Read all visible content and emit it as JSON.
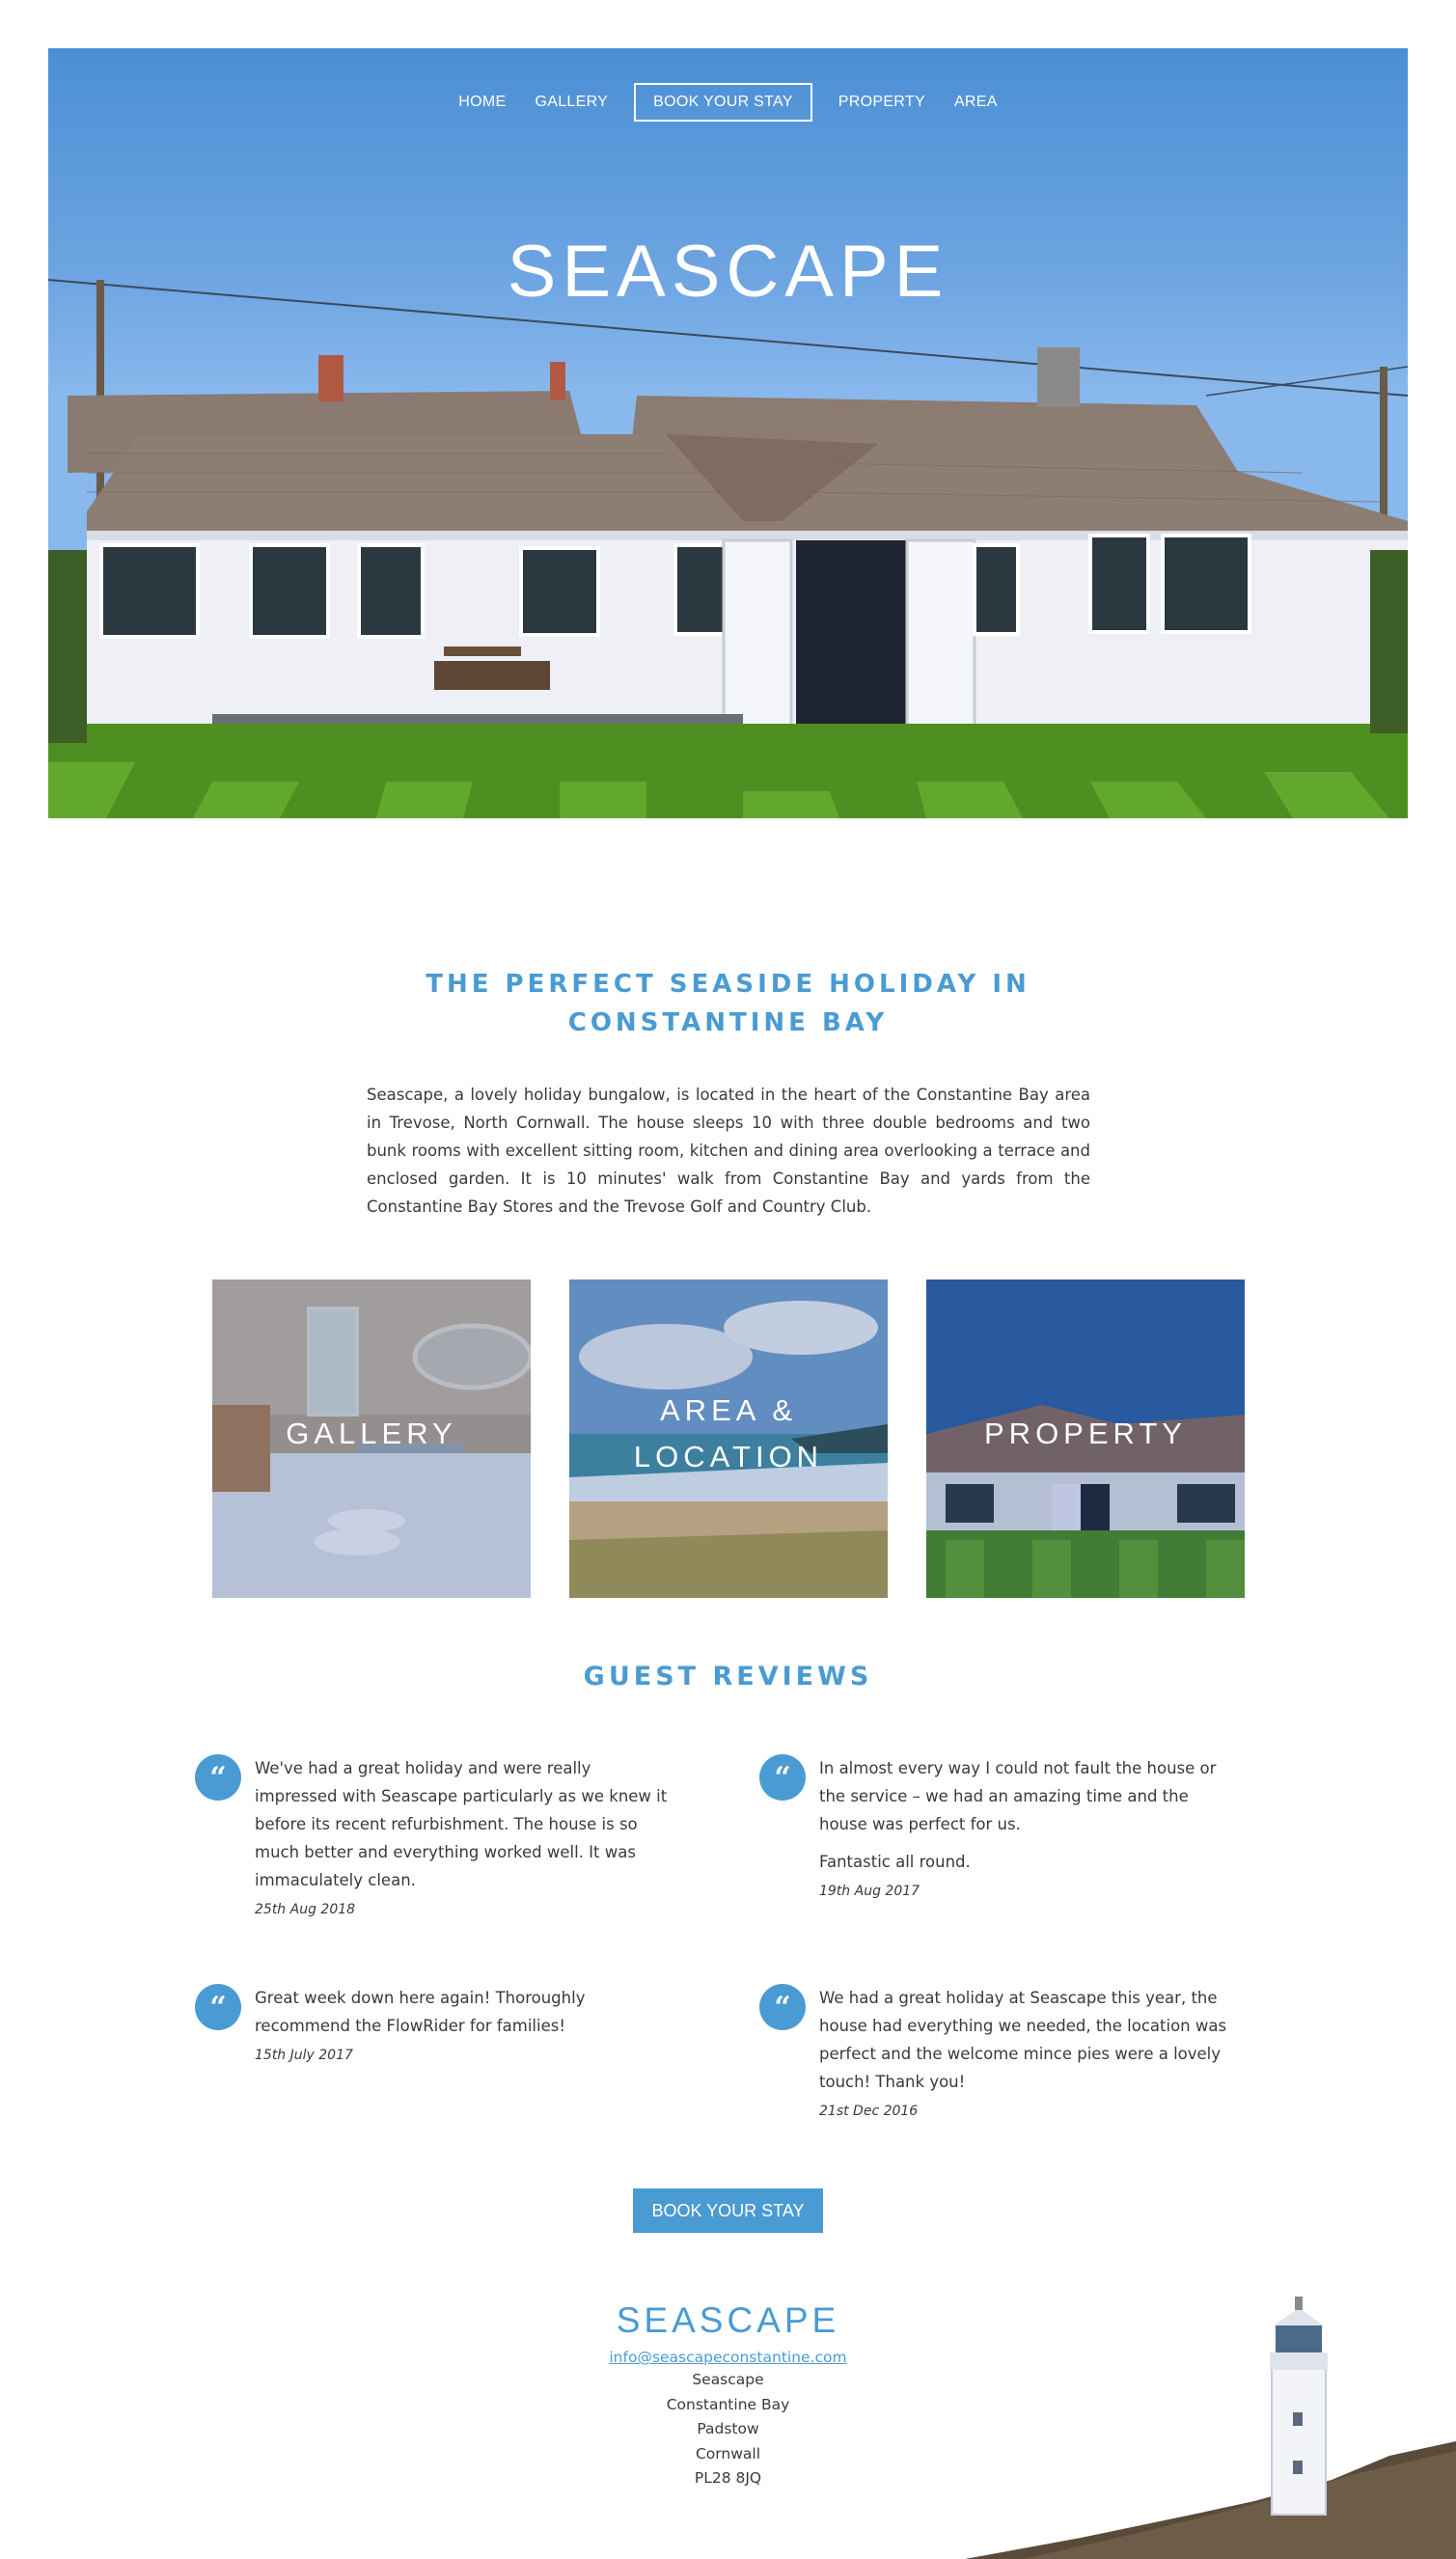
{
  "nav": {
    "items": [
      {
        "label": "HOME"
      },
      {
        "label": "GALLERY"
      },
      {
        "label": "BOOK YOUR STAY"
      },
      {
        "label": "PROPERTY"
      },
      {
        "label": "AREA"
      }
    ]
  },
  "hero": {
    "logo": "SEASCAPE"
  },
  "intro": {
    "title_line1": "THE PERFECT SEASIDE HOLIDAY IN",
    "title_line2": "CONSTANTINE BAY",
    "text": "Seascape, a lovely holiday bungalow, is located in the heart of the Constantine Bay area in Trevose, North Cornwall. The house sleeps 10 with three double bedrooms and two bunk rooms with excellent sitting room, kitchen and dining area overlooking a terrace and enclosed garden. It is 10 minutes' walk from Constantine Bay and yards from the Constantine Bay Stores and the Trevose Golf and Country Club."
  },
  "tiles": [
    {
      "line1": "GALLERY",
      "line2": ""
    },
    {
      "line1": "AREA &",
      "line2": "LOCATION"
    },
    {
      "line1": "PROPERTY",
      "line2": ""
    }
  ],
  "reviews": {
    "title": "GUEST REVIEWS",
    "items": [
      {
        "paragraphs": [
          "We've had a great holiday and were really impressed with Seascape particularly as we knew it before its recent refurbishment. The house is so much better and everything worked well. It was immaculately clean."
        ],
        "date": "25th Aug 2018"
      },
      {
        "paragraphs": [
          "In almost every way I could not fault the house or the service  – we had an amazing time and the house was perfect for us.",
          "Fantastic all round."
        ],
        "date": "19th Aug 2017"
      },
      {
        "paragraphs": [
          "Great week down here again! Thoroughly recommend the FlowRider for families!"
        ],
        "date": "15th July 2017"
      },
      {
        "paragraphs": [
          "We had a great holiday at Seascape this year, the house had everything we needed, the location was perfect and the welcome mince pies were a lovely touch! Thank you!"
        ],
        "date": "21st Dec 2016"
      }
    ]
  },
  "cta": {
    "label": "BOOK YOUR STAY"
  },
  "footer": {
    "logo": "SEASCAPE",
    "email": "info@seascapeconstantine.com",
    "address": [
      "Seascape",
      "Constantine Bay",
      "Padstow",
      "Cornwall",
      "PL28 8JQ"
    ]
  },
  "colors": {
    "accent": "#4a9bd3",
    "text": "#3a3a3a"
  },
  "icons": {
    "quote": "quote-icon"
  }
}
